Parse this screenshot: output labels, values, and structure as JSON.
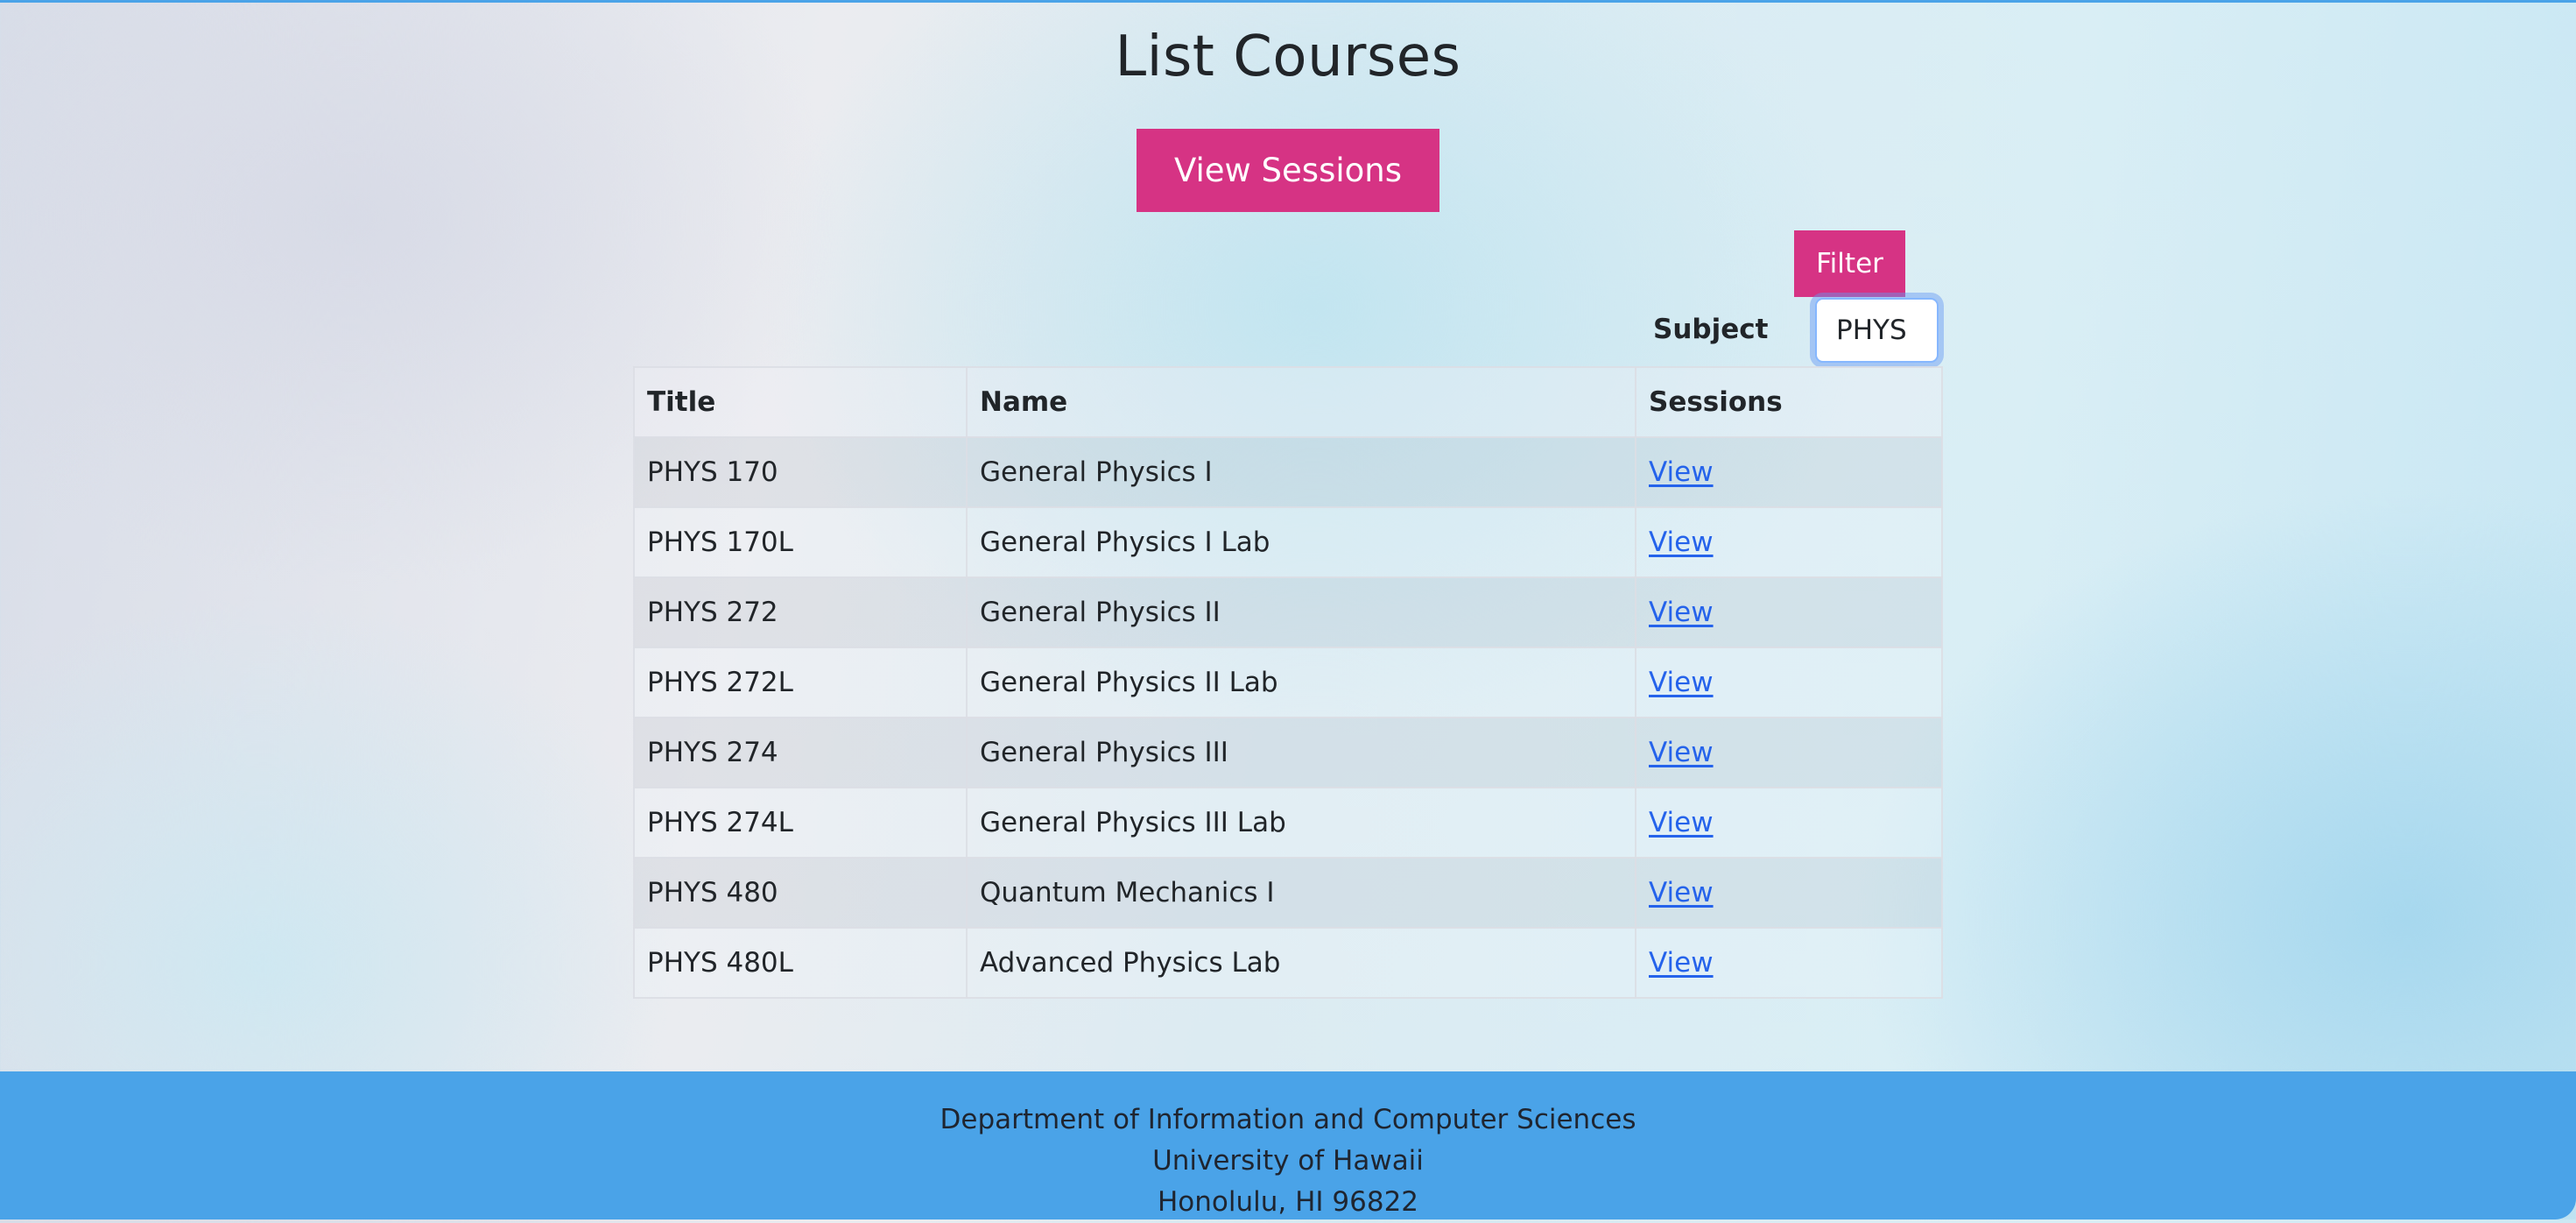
{
  "page": {
    "title": "List Courses",
    "view_sessions_label": "View Sessions"
  },
  "filter": {
    "button_label": "Filter",
    "subject_label": "Subject",
    "subject_value": "PHYS"
  },
  "table": {
    "headers": [
      "Title",
      "Name",
      "Sessions"
    ],
    "rows": [
      {
        "title": "PHYS 170",
        "name": "General Physics I",
        "link": "View"
      },
      {
        "title": "PHYS 170L",
        "name": "General Physics I Lab",
        "link": "View"
      },
      {
        "title": "PHYS 272",
        "name": "General Physics II",
        "link": "View"
      },
      {
        "title": "PHYS 272L",
        "name": "General Physics II Lab",
        "link": "View"
      },
      {
        "title": "PHYS 274",
        "name": "General Physics III",
        "link": "View"
      },
      {
        "title": "PHYS 274L",
        "name": "General Physics III Lab",
        "link": "View"
      },
      {
        "title": "PHYS 480",
        "name": "Quantum Mechanics I",
        "link": "View"
      },
      {
        "title": "PHYS 480L",
        "name": "Advanced Physics Lab",
        "link": "View"
      }
    ]
  },
  "footer": {
    "line1": "Department of Information and Computer Sciences",
    "line2": "University of Hawaii",
    "line3": "Honolulu, HI 96822"
  },
  "colors": {
    "accent_pink": "#d63384",
    "footer_blue": "#4aa3e8",
    "link_blue": "#2563eb"
  }
}
